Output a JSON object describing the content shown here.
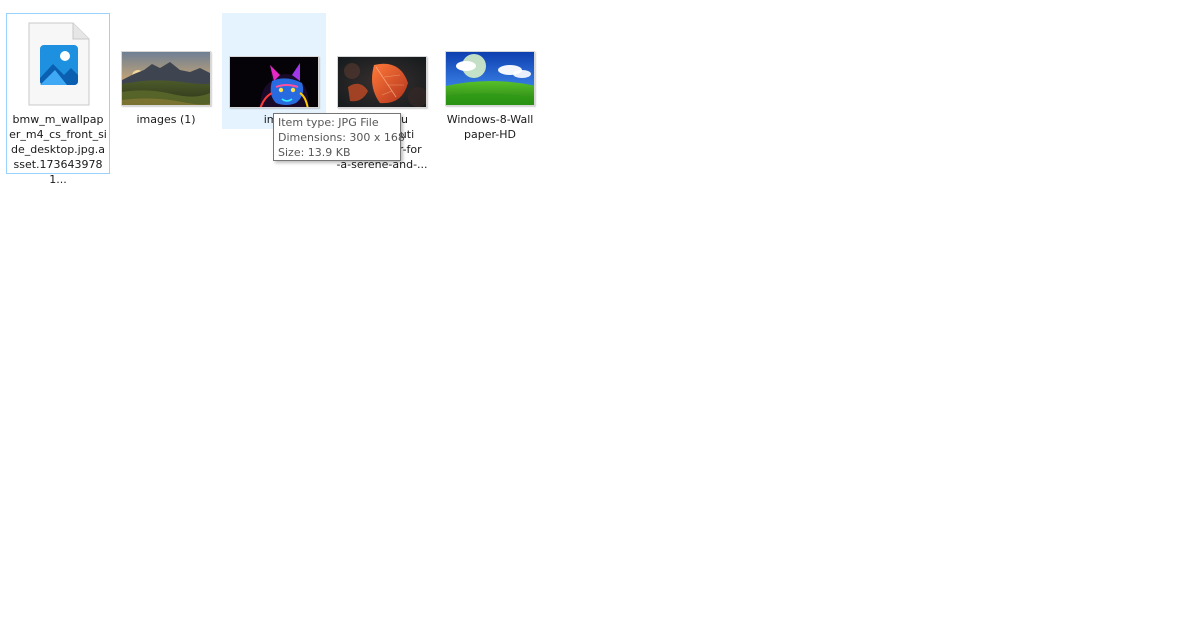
{
  "files": [
    {
      "name": "bmw_m_wallpaper_m4_cs_front_side_desktop.jpg.asset.1736439781...",
      "label_lines": [
        "bmw_m_wallpap",
        "er_m4_cs_front_si",
        "de_desktop.jpg.a",
        "sset.1736439781..."
      ],
      "icon": "photo-file-icon",
      "state": "focused"
    },
    {
      "name": "images (1)",
      "label_lines": [
        "images (1)"
      ],
      "icon": "landscape-thumbnail",
      "state": "normal"
    },
    {
      "name": "images",
      "label_lines": [
        "ima"
      ],
      "icon": "neon-cat-thumbnail",
      "state": "hovered"
    },
    {
      "name": "...grou...oluti...er-for-a-serene-and-...",
      "label_lines": [
        "grou",
        "oluti",
        "er-for",
        "-a-serene-and-..."
      ],
      "icon": "autumn-leaf-thumbnail",
      "state": "normal"
    },
    {
      "name": "Windows-8-Wallpaper-HD",
      "label_lines": [
        "Windows-8-Wall",
        "paper-HD"
      ],
      "icon": "green-hills-thumbnail",
      "state": "normal"
    }
  ],
  "tooltip": {
    "type_line": "Item type: JPG File",
    "dimensions_line": "Dimensions: 300 x 168",
    "size_line": "Size: 13.9 KB"
  },
  "colors": {
    "selection_border": "#99d1ff",
    "hover_background": "#e5f3ff",
    "tooltip_border": "#767676"
  }
}
